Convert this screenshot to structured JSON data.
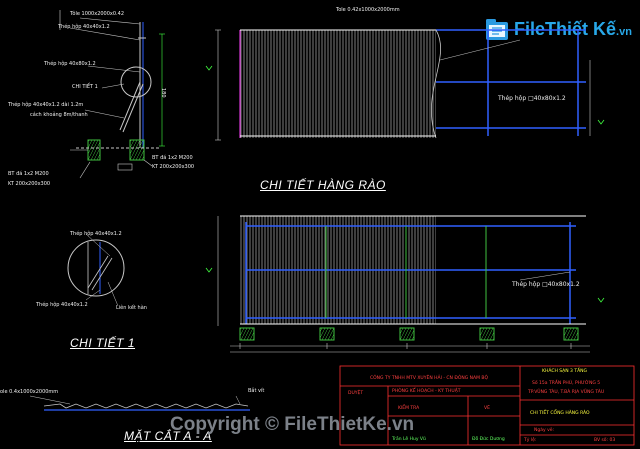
{
  "logo": {
    "text": "File",
    "text2": "Thiết Kế",
    "suffix": ".vn"
  },
  "watermark": "Copyright © FileThietKe.vn",
  "headings": {
    "fence_detail": "CHI TIẾT HÀNG RÀO",
    "detail_1": "CHI TIẾT 1",
    "section_aa": "MẶT CẮT A - A"
  },
  "labels": {
    "sheet_top": "Tôle 1000x2000x0.42",
    "box_40x40": "Thép hộp 40x40x1.2",
    "box_40x80": "Thép hộp 40x80x1.2",
    "detail1_marker": "CHI TIẾT 1",
    "box_brace": "Thép hộp 40x40x1.2 dài 1.2m",
    "brace_note": "cách khoảng 8m/thanh",
    "bt_left_1": "BT đá 1x2 M200",
    "bt_left_2": "KT 200x200x300",
    "bt_right_1": "BT đá 1x2 M200",
    "bt_right_2": "KT 200x200x300",
    "elev_sheet": "Tole 0.42x1000x2000mm",
    "elev_box_top": "Thép hộp □40x80x1.2",
    "elev_box_bottom": "Thép hộp □40x80x1.2",
    "d1_box_top": "Thép hộp 40x40x1.2",
    "d1_box_bottom": "Thép hộp 40x40x1.2",
    "d1_weld": "Liên kết hàn",
    "sec_sheet": "ole 0.4x1000x2000mm",
    "sec_bolt": "Bắt vít",
    "dim_h": "180"
  },
  "title_block": {
    "company": "CÔNG TY TNHH MTV XUYÊN HẢI - CN ĐÔNG NAM BỘ",
    "approve": "DUYỆT",
    "dept": "PHÒNG KẾ HOẠCH - KỸ THUẬT",
    "check": "KIỂM TRA",
    "draw": "VẼ",
    "checker": "Trần Lê Huy Vũ",
    "drafter": "Đỗ Đức Dương",
    "project": "KHÁCH SẠN 3 TẦNG",
    "address1": "Số 15a TRẦN PHÚ, PHƯỜNG 5",
    "address2": "TP.VŨNG TÀU, T.BÀ RỊA VŨNG TÀU",
    "drawing_title": "CHI TIẾT CỔNG HÀNG RÀO",
    "date_label": "Ngày vẽ:",
    "scale_label": "Tỷ lệ:",
    "sheet_no": "BV số: 03"
  }
}
